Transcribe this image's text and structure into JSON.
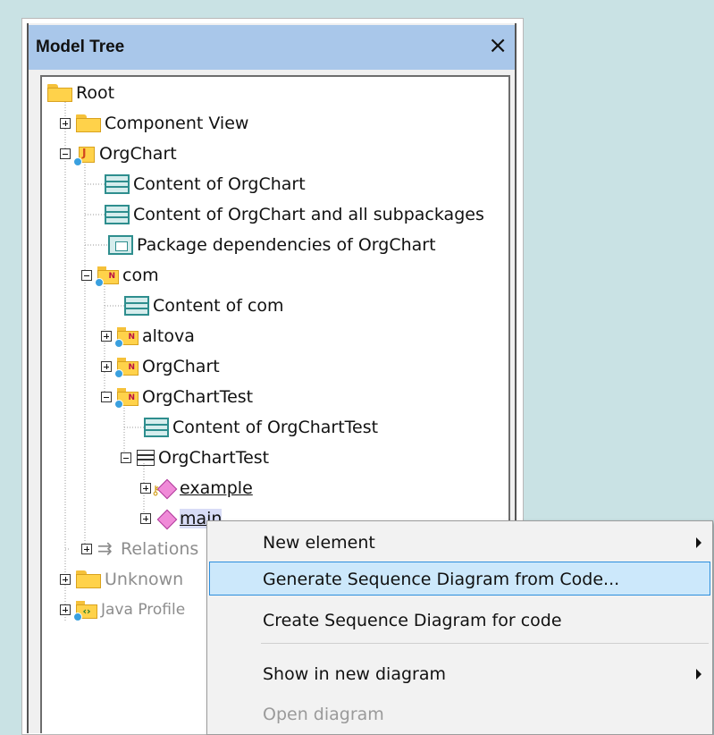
{
  "panel": {
    "title": "Model Tree",
    "close_glyph": "×"
  },
  "tree": {
    "root": "Root",
    "component_view": "Component View",
    "orgchart": "OrgChart",
    "content_orgchart": "Content of OrgChart",
    "content_orgchart_all": "Content of OrgChart and all subpackages",
    "pkg_deps": "Package dependencies of OrgChart",
    "com": "com",
    "content_com": "Content of com",
    "altova": "altova",
    "orgchart_ns": "OrgChart",
    "orgcharttest_ns": "OrgChartTest",
    "content_orgcharttest": "Content of OrgChartTest",
    "orgcharttest_class": "OrgChartTest",
    "example": "example",
    "main": "main",
    "relations": "Relations",
    "unknown": "Unknown",
    "java_profile": "Java Profile"
  },
  "context_menu": {
    "new_element": "New element",
    "generate_seq": "Generate Sequence Diagram from Code...",
    "create_seq": "Create Sequence Diagram for code",
    "show_in_new": "Show in new diagram",
    "open_diagram": "Open diagram"
  }
}
